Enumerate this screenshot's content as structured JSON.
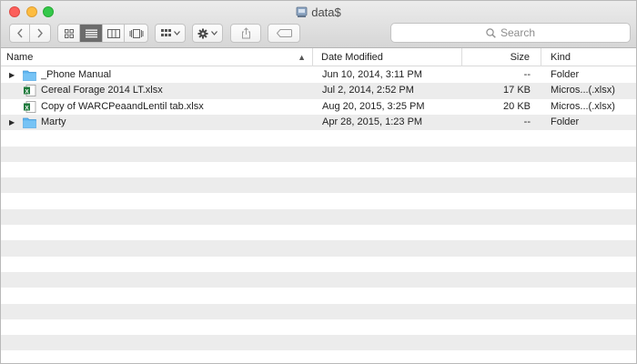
{
  "window": {
    "title": "data$"
  },
  "search": {
    "placeholder": "Search"
  },
  "columns": {
    "name": "Name",
    "date": "Date Modified",
    "size": "Size",
    "kind": "Kind"
  },
  "files": [
    {
      "name": "_Phone Manual",
      "date": "Jun 10, 2014, 3:11 PM",
      "size": "--",
      "kind": "Folder",
      "type": "folder"
    },
    {
      "name": "Cereal Forage 2014 LT.xlsx",
      "date": "Jul 2, 2014, 2:52 PM",
      "size": "17 KB",
      "kind": "Micros...(.xlsx)",
      "type": "excel"
    },
    {
      "name": "Copy of WARCPeaandLentil tab.xlsx",
      "date": "Aug 20, 2015, 3:25 PM",
      "size": "20 KB",
      "kind": "Micros...(.xlsx)",
      "type": "excel"
    },
    {
      "name": "Marty",
      "date": "Apr 28, 2015, 1:23 PM",
      "size": "--",
      "kind": "Folder",
      "type": "folder"
    }
  ],
  "colors": {
    "folder": "#5eb5f0",
    "excel_green": "#1f7a3c",
    "stripe": "#ececec"
  }
}
